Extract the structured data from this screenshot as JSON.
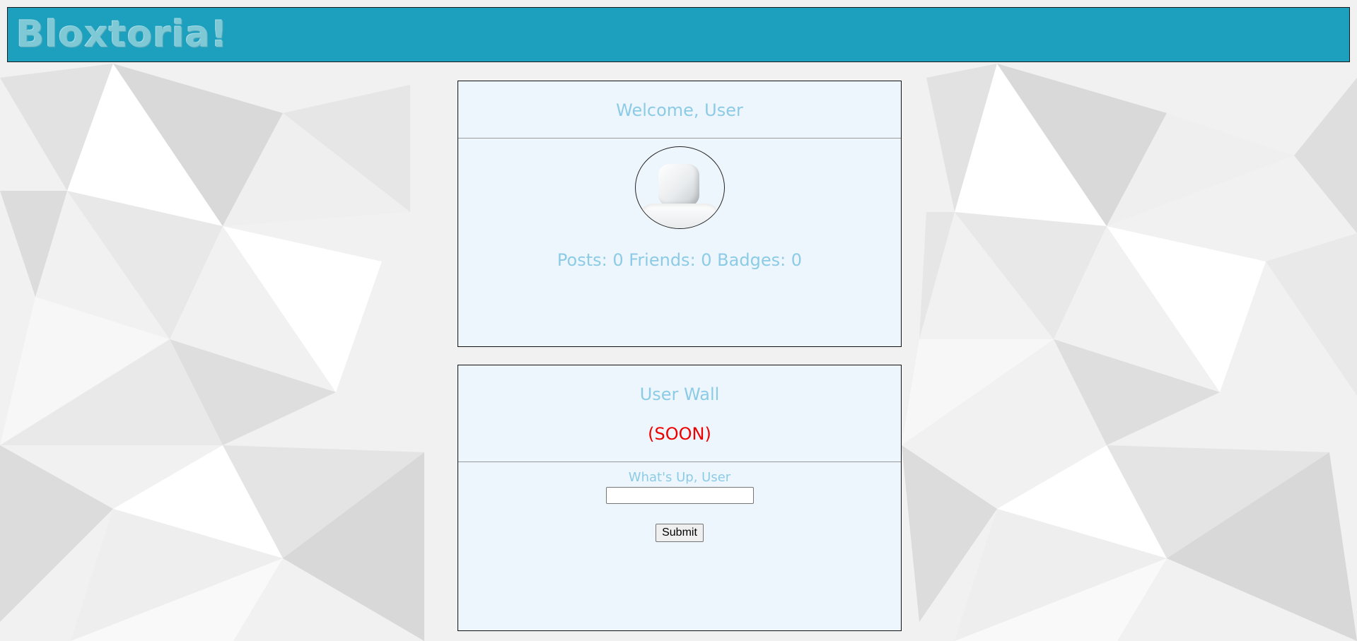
{
  "header": {
    "logo_text": "Bloxtoria!"
  },
  "profile": {
    "welcome": "Welcome, User",
    "stats": "Posts: 0 Friends: 0 Badges: 0"
  },
  "wall": {
    "title": "User Wall",
    "status": "(SOON)",
    "prompt": "What's Up, User",
    "input_value": "",
    "submit_label": "Submit"
  },
  "colors": {
    "header_bg": "#1d9fbe",
    "logo": "#7fc8d6",
    "panel_bg": "#eef6fd",
    "accent_text": "#8ccbe6",
    "soon_text": "#ee0000"
  }
}
